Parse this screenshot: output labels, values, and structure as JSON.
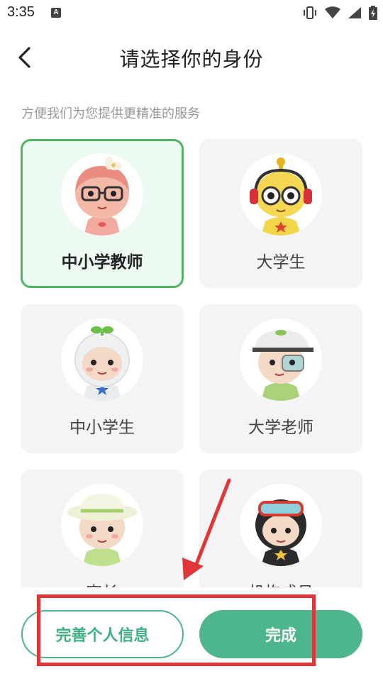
{
  "status_bar": {
    "time": "3:35",
    "notification_letter": "A",
    "icons": [
      "vibrate-icon",
      "wifi-icon",
      "signal-icon",
      "battery-icon"
    ]
  },
  "header": {
    "back_icon": "chevron-left-icon",
    "title": "请选择你的身份"
  },
  "subtitle": "方便我们为您提供更精准的服务",
  "roles": [
    {
      "label": "中小学教师",
      "selected": true,
      "icon": "teacher-avatar"
    },
    {
      "label": "大学生",
      "selected": false,
      "icon": "college-student-avatar"
    },
    {
      "label": "中小学生",
      "selected": false,
      "icon": "student-avatar"
    },
    {
      "label": "大学老师",
      "selected": false,
      "icon": "professor-avatar"
    },
    {
      "label": "家长",
      "selected": false,
      "icon": "parent-avatar"
    },
    {
      "label": "机构成员",
      "selected": false,
      "icon": "institution-member-avatar"
    }
  ],
  "buttons": {
    "complete_profile": "完善个人信息",
    "done": "完成"
  },
  "colors": {
    "accent": "#4db68d",
    "selected_border": "#54b466",
    "selected_bg": "#ecfaf2",
    "annotation": "#e0363a"
  }
}
